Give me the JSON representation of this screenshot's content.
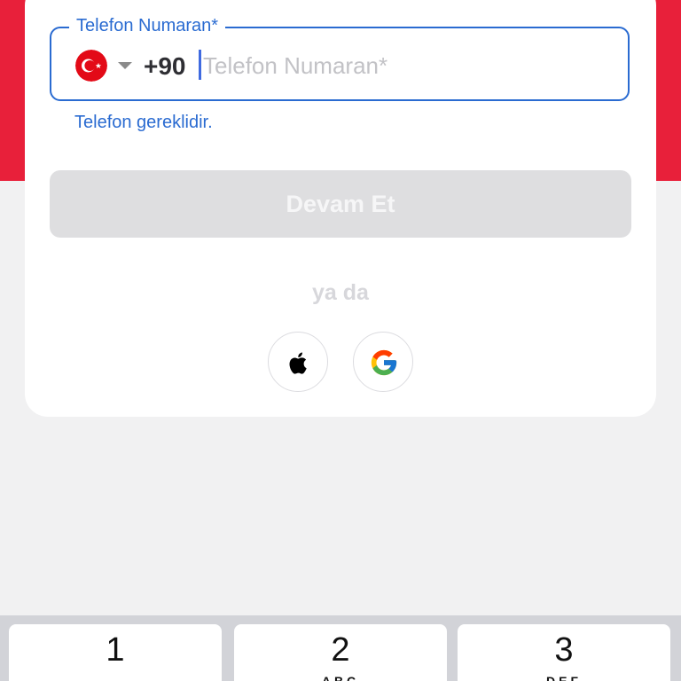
{
  "form": {
    "phone_label": "Telefon Numaran*",
    "dial_code": "+90",
    "phone_value": "",
    "phone_placeholder": "Telefon Numaran*",
    "error_text": "Telefon gereklidir.",
    "country_flag": "turkey-flag-icon",
    "continue_label": "Devam Et",
    "or_text": "ya da"
  },
  "social": [
    {
      "icon": "apple-icon"
    },
    {
      "icon": "google-icon"
    }
  ],
  "keyboard": {
    "keys": [
      {
        "digit": "1",
        "letters": ""
      },
      {
        "digit": "2",
        "letters": "ABC"
      },
      {
        "digit": "3",
        "letters": "DEF"
      }
    ]
  },
  "colors": {
    "brand_red": "#e8203a",
    "accent_blue": "#2a6bd1",
    "disabled_button": "#dedee0",
    "background": "#f1f1f2"
  }
}
